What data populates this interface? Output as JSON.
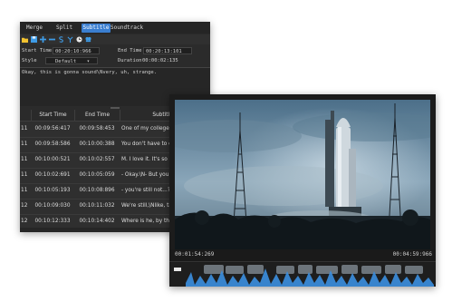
{
  "editor": {
    "tabs": [
      "Merge",
      "Split",
      "Subtitle",
      "Soundtrack"
    ],
    "active_tab": "Subtitle",
    "start_time_label": "Start Time",
    "start_time_value": "00:20:10:966",
    "end_time_label": "End Time",
    "end_time_value": "00:20:13:101",
    "style_label": "Style",
    "style_value": "Default",
    "duration_label": "Duration",
    "duration_value": "00:00:02:135",
    "text": "Okay, this is gonna sound\\Nvery, uh, strange.",
    "columns": [
      "Start Time",
      "End Time",
      "Subtitle"
    ],
    "rows": [
      {
        "idx": "11",
        "start": "00:09:56:417",
        "end": "00:09:58:453",
        "text": "One of my college friends,..."
      },
      {
        "idx": "11",
        "start": "00:09:58:586",
        "end": "00:10:00:388",
        "text": "You don't have to call me t..."
      },
      {
        "idx": "11",
        "start": "00:10:00:521",
        "end": "00:10:02:557",
        "text": "M. I love it. It's so hot."
      },
      {
        "idx": "11",
        "start": "00:10:02:691",
        "end": "00:10:05:059",
        "text": "- Okay.\\N- But you and Spe..."
      },
      {
        "idx": "11",
        "start": "00:10:05:193",
        "end": "00:10:08:896",
        "text": "- you're still not...?\\N- Yeah..."
      },
      {
        "idx": "12",
        "start": "00:10:09:030",
        "end": "00:10:11:032",
        "text": "We're still,\\Nlike, taking a b..."
      },
      {
        "idx": "12",
        "start": "00:10:12:333",
        "end": "00:10:14:402",
        "text": "Where is he, by the way?"
      }
    ]
  },
  "player": {
    "current_time": "00:01:54:269",
    "total_time": "00:04:59:966"
  },
  "colors": {
    "accent": "#3a7ed0",
    "toolbar_yellow": "#f2c230",
    "toolbar_blue": "#3e9be6",
    "waveform": "#3b8fe0"
  }
}
